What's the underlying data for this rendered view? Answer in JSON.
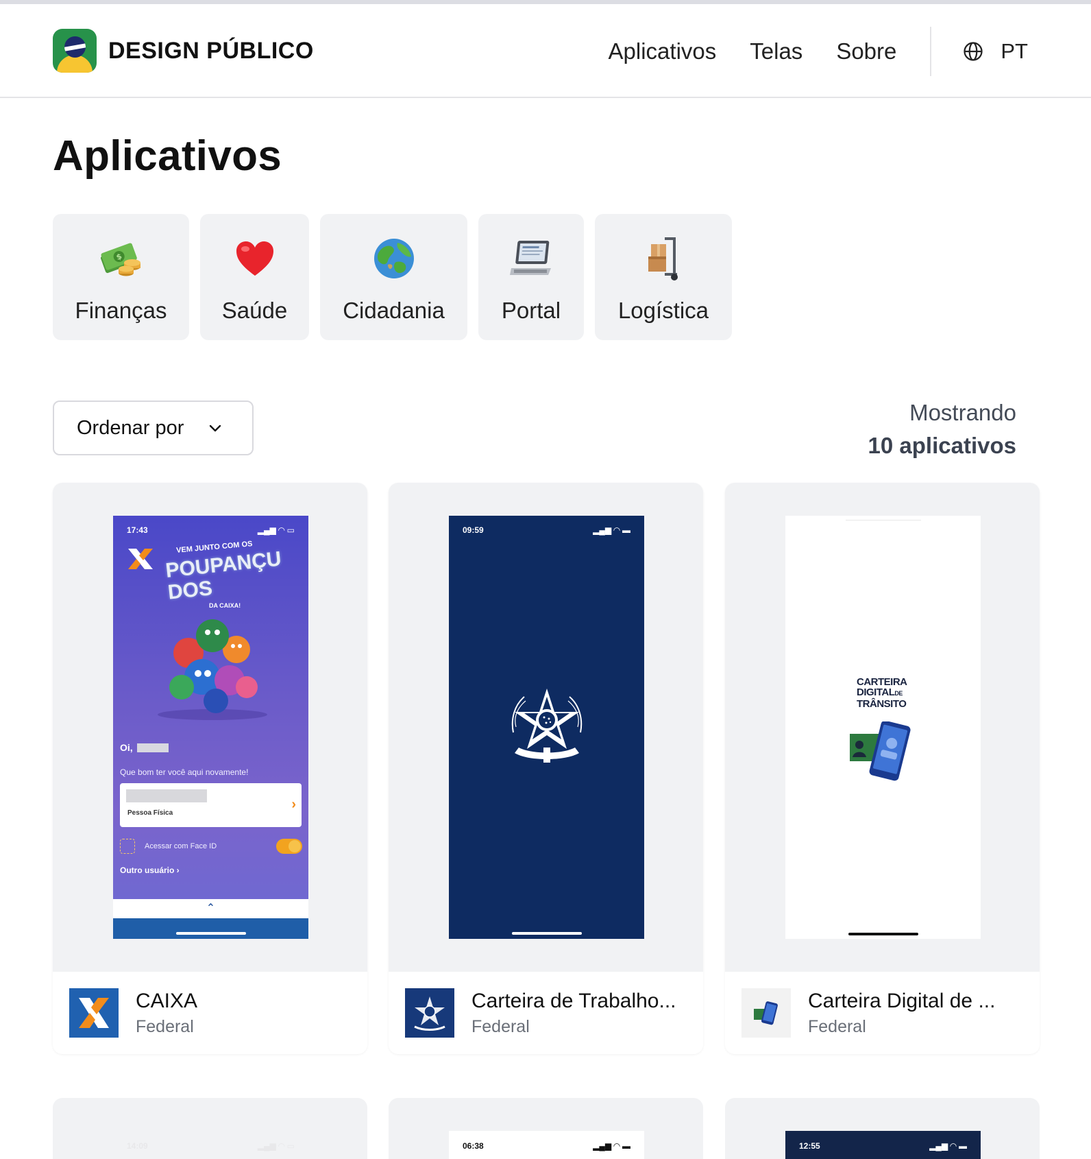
{
  "header": {
    "logo_text": "DESIGN PÚBLICO",
    "nav": [
      {
        "label": "Aplicativos"
      },
      {
        "label": "Telas"
      },
      {
        "label": "Sobre"
      }
    ],
    "language": "PT"
  },
  "page": {
    "title": "Aplicativos"
  },
  "categories": [
    {
      "label": "Finanças",
      "icon": "money-bag-icon"
    },
    {
      "label": "Saúde",
      "icon": "heart-icon"
    },
    {
      "label": "Cidadania",
      "icon": "globe-icon"
    },
    {
      "label": "Portal",
      "icon": "laptop-icon"
    },
    {
      "label": "Logística",
      "icon": "hand-truck-icon"
    }
  ],
  "sort": {
    "label": "Ordenar por"
  },
  "count": {
    "line1": "Mostrando",
    "line2": "10 aplicativos"
  },
  "apps": [
    {
      "name": "CAIXA",
      "scope": "Federal",
      "screen": {
        "time": "17:43",
        "header": "VEM JUNTO COM OS",
        "brand": "POUPANÇUDOS",
        "subbrand": "DA CAIXA!",
        "greeting_prefix": "Oi,",
        "greeting": "Que bom ter você aqui novamente!",
        "account_type": "Pessoa Física",
        "faceid_label": "Acessar com Face ID",
        "other_user": "Outro usuário"
      }
    },
    {
      "name": "Carteira de Trabalho...",
      "scope": "Federal",
      "screen": {
        "time": "09:59"
      }
    },
    {
      "name": "Carteira Digital de ...",
      "scope": "Federal",
      "screen": {
        "brand_line1": "CARTEIRA",
        "brand_line2": "DIGITAL",
        "brand_line2_small": "DE",
        "brand_line3": "TRÂNSITO"
      }
    }
  ],
  "next_row": [
    {
      "time": "14:09"
    },
    {
      "time": "06:38"
    },
    {
      "time": "12:55"
    }
  ],
  "colors": {
    "accent_green": "#27924a",
    "accent_yellow": "#f7c531",
    "card_bg": "#f1f2f4",
    "caixa_blue": "#1f5ea8",
    "caixa_orange": "#f28c1b",
    "gov_navy": "#0e2b61"
  }
}
